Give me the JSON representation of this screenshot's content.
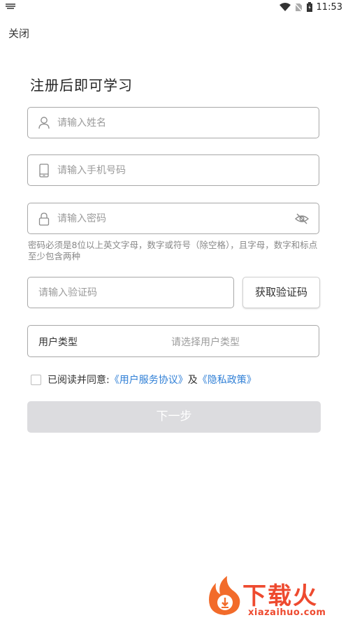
{
  "status_bar": {
    "time": "11:53"
  },
  "header": {
    "close_label": "关闭"
  },
  "form": {
    "title": "注册后即可学习",
    "name": {
      "placeholder": "请输入姓名"
    },
    "phone": {
      "placeholder": "请输入手机号码"
    },
    "password": {
      "placeholder": "请输入密码"
    },
    "password_hint": "密码必须是8位以上英文字母，数字或符号（除空格），且字母，数字和标点至少包含两种",
    "verify_code": {
      "placeholder": "请输入验证码",
      "button_label": "获取验证码"
    },
    "user_type": {
      "label": "用户类型",
      "placeholder": "请选择用户类型"
    },
    "agreement": {
      "prefix": "已阅读并同意:",
      "user_agreement": "《用户服务协议》",
      "conjunction": "及",
      "privacy_policy": "《隐私政策》",
      "checked": false
    },
    "next_button": "下一步"
  },
  "watermark": {
    "title": "下载火",
    "url": "xiazaihuo.com"
  },
  "colors": {
    "link": "#2f7fd6",
    "disabled_button": "#dcdcdf",
    "border": "#a8a8a8",
    "watermark": "#ee4a2f"
  }
}
